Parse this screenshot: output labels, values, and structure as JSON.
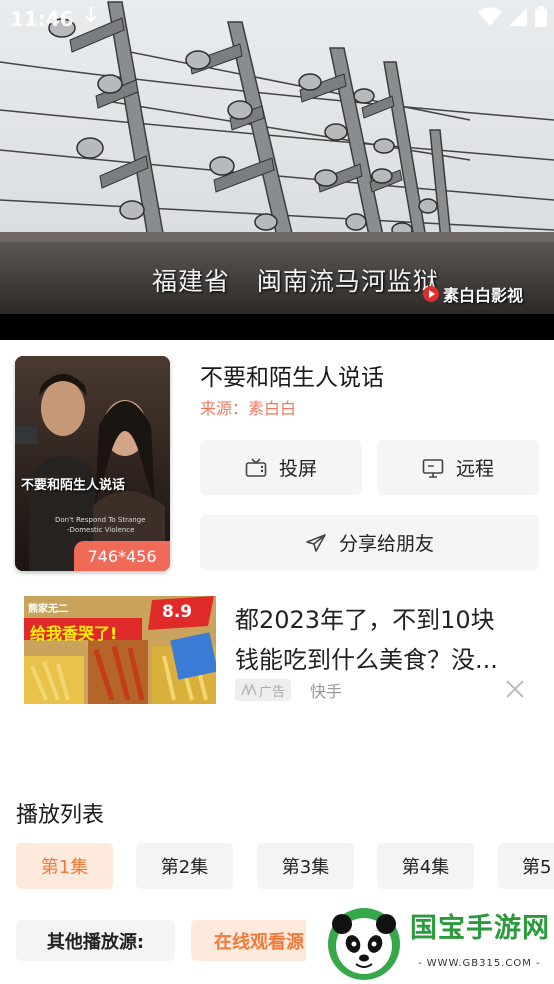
{
  "status_bar": {
    "time": "11:46",
    "download_icon": "download-arrow-icon",
    "icons": [
      "wifi-icon",
      "signal-icon",
      "battery-icon"
    ]
  },
  "player": {
    "subtitle": "福建省   闽南流马河监狱",
    "watermark": "素白白影视"
  },
  "detail": {
    "title": "不要和陌生人说话",
    "source": "来源：素白白",
    "poster_badge": "746*456",
    "poster_title": "不要和陌生人说话",
    "poster_subtitle_1": "Don't  Respond To Strange",
    "poster_subtitle_2": "-Domestic Violence"
  },
  "actions": {
    "cast_label": "投屏",
    "remote_label": "远程",
    "share_label": "分享给朋友"
  },
  "ad": {
    "text_line1": "都2023年了，不到10块",
    "text_line2": "钱能吃到什么美食？没...",
    "tag": "广告",
    "brand": "快手",
    "thumb_banner": "给我香哭了!",
    "thumb_brand": "熊家无二",
    "thumb_price": "8.9"
  },
  "playlist": {
    "title": "播放列表",
    "episodes": [
      "第1集",
      "第2集",
      "第3集",
      "第4集",
      "第5"
    ],
    "active_index": 0
  },
  "sources": {
    "label": "其他播放源:",
    "online": "在线观看源"
  },
  "site": {
    "name": "国宝手游网",
    "url": "- WWW.GB315.COM -"
  },
  "colors": {
    "accent": "#f07a3c",
    "accent_bg": "#fdeadd",
    "source_text": "#f07860",
    "badge": "#f06b57",
    "site_green": "#2a9a3c"
  }
}
